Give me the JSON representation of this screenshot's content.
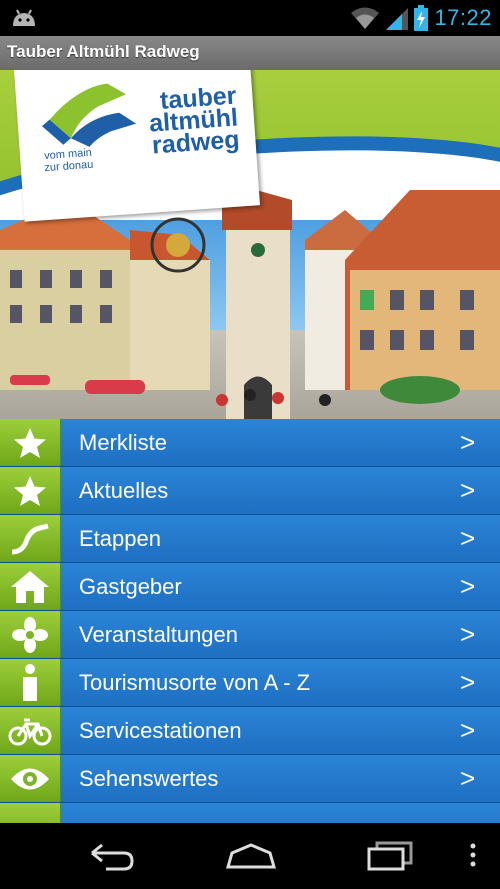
{
  "status_bar": {
    "time": "17:22"
  },
  "app": {
    "title": "Tauber Altmühl Radweg"
  },
  "logo": {
    "line1": "tauber",
    "line2": "altmühl",
    "line3": "radweg",
    "tagline1": "vom main",
    "tagline2": "zur donau"
  },
  "menu": {
    "items": [
      {
        "label": "Merkliste",
        "icon": "star-icon"
      },
      {
        "label": "Aktuelles",
        "icon": "star-icon"
      },
      {
        "label": "Etappen",
        "icon": "route-icon"
      },
      {
        "label": "Gastgeber",
        "icon": "house-icon"
      },
      {
        "label": "Veranstaltungen",
        "icon": "flower-icon"
      },
      {
        "label": "Tourismusorte von A - Z",
        "icon": "info-icon"
      },
      {
        "label": "Servicestationen",
        "icon": "bicycle-icon"
      },
      {
        "label": "Sehenswertes",
        "icon": "eye-icon"
      }
    ],
    "chevron": ">"
  },
  "colors": {
    "accent": "#33b5e5",
    "menu_blue": "#1e72c7",
    "icon_green": "#8cc22e"
  }
}
